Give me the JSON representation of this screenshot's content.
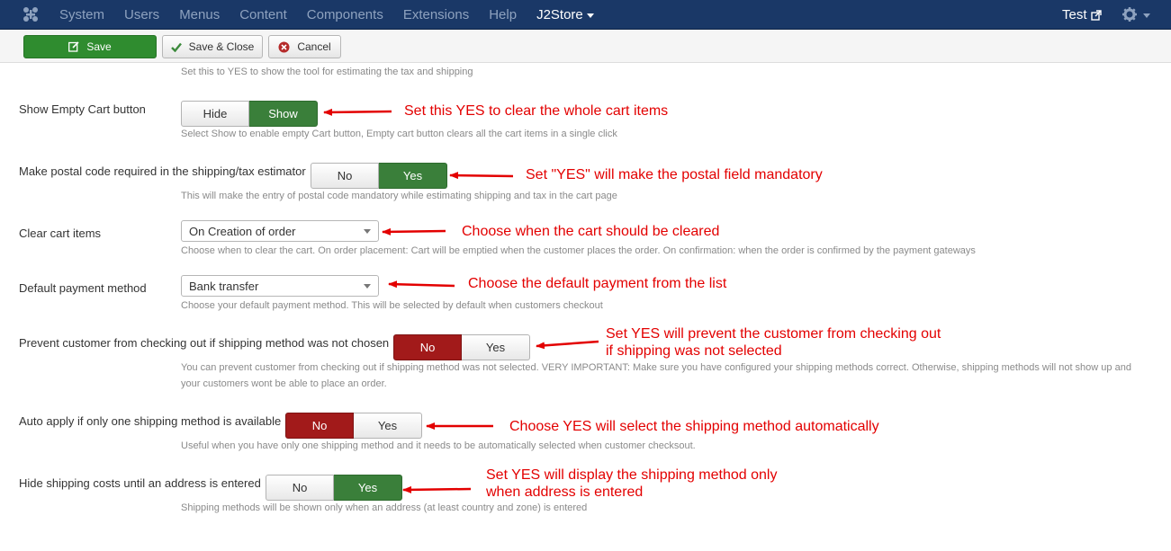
{
  "navbar": {
    "menu": [
      "System",
      "Users",
      "Menus",
      "Content",
      "Components",
      "Extensions",
      "Help"
    ],
    "active_menu": "J2Store",
    "user": "Test"
  },
  "toolbar": {
    "save_label": "Save",
    "save_close_label": "Save & Close",
    "cancel_label": "Cancel"
  },
  "top_help": "Set this to YES to show the tool for estimating the tax and shipping",
  "settings": {
    "empty_cart": {
      "label": "Show Empty Cart button",
      "options": [
        "Hide",
        "Show"
      ],
      "selected": "Show",
      "help": "Select Show to enable empty Cart button, Empty cart button clears all the cart items in a single click",
      "note": "Set this YES to clear the whole cart items"
    },
    "postal_required": {
      "label": "Make postal code required in the shipping/tax estimator",
      "options": [
        "No",
        "Yes"
      ],
      "selected": "Yes",
      "help": "This will make the entry of postal code mandatory while estimating shipping and tax in the cart page",
      "note": "Set \"YES\" will make the postal field mandatory"
    },
    "clear_cart": {
      "label": "Clear cart items",
      "value": "On Creation of order",
      "help": "Choose when to clear the cart. On order placement: Cart will be emptied when the customer places the order. On confirmation: when the order is confirmed by the payment gateways",
      "note": "Choose when the cart should be cleared"
    },
    "payment_method": {
      "label": "Default payment method",
      "value": "Bank transfer",
      "help": "Choose your default payment method. This will be selected by default when customers checkout",
      "note": "Choose the default payment from the list"
    },
    "prevent_checkout": {
      "label": "Prevent customer from checking out if shipping method was not chosen",
      "options": [
        "No",
        "Yes"
      ],
      "selected": "No",
      "help_line1": "You can prevent customer from checking out if shipping method was not selected. VERY IMPORTANT: Make sure you have configured your shipping methods correct. Otherwise, shipping methods will not show up and",
      "help_line2": "your customers wont be able to place an order.",
      "note_line1": "Set YES will prevent the customer from checking out",
      "note_line2": "if shipping was not selected"
    },
    "auto_apply": {
      "label": "Auto apply if only one shipping method is available",
      "options": [
        "No",
        "Yes"
      ],
      "selected": "No",
      "help": "Useful when you have only one shipping method and it needs to be automatically selected when customer checksout.",
      "note": "Choose YES will select the shipping method automatically"
    },
    "hide_shipping": {
      "label": "Hide shipping costs until an address is entered",
      "options": [
        "No",
        "Yes"
      ],
      "selected": "Yes",
      "help": "Shipping methods will be shown only when an address (at least country and zone) is entered",
      "note_line1": "Set YES will display the shipping method only",
      "note_line2": "when address is entered"
    }
  },
  "colors": {
    "navbar": "#1a3867",
    "save": "#2f8c2f",
    "toggle_on_green": "#3a7f3a",
    "toggle_on_red": "#a21a1a",
    "annotation": "#e30000"
  }
}
